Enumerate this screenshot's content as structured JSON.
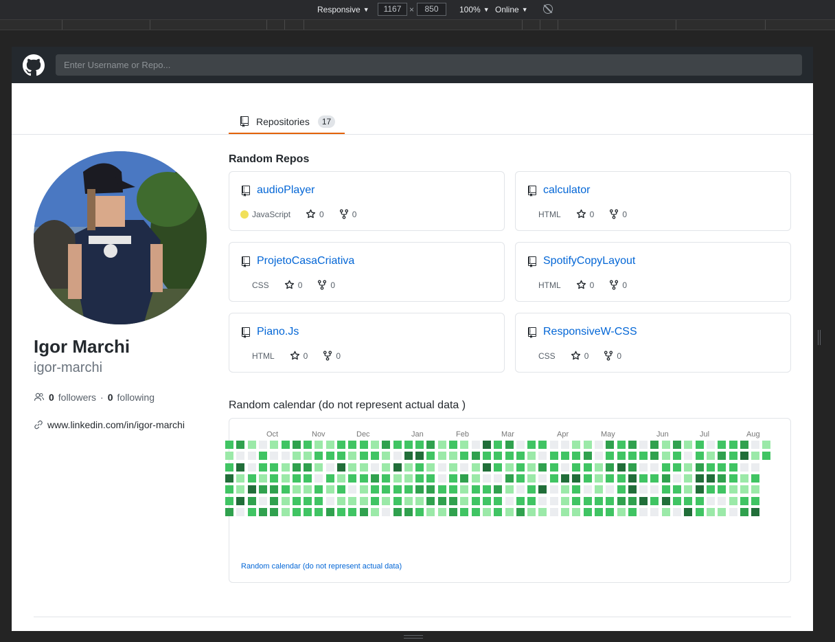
{
  "devtools": {
    "device": "Responsive",
    "width": "1167",
    "height": "850",
    "zoom": "100%",
    "network": "Online"
  },
  "header": {
    "search_placeholder": "Enter Username or Repo..."
  },
  "tabs": [
    {
      "label": "Repositories",
      "count": "17"
    }
  ],
  "profile": {
    "name": "Igor Marchi",
    "login": "igor-marchi",
    "followers": "0",
    "followers_label": "followers",
    "separator": "·",
    "following": "0",
    "following_label": "following",
    "website": "www.linkedin.com/in/igor-marchi"
  },
  "repos_section": {
    "title": "Random Repos",
    "repos": [
      {
        "name": "audioPlayer",
        "language": "JavaScript",
        "stars": "0",
        "forks": "0"
      },
      {
        "name": "calculator",
        "language": "HTML",
        "stars": "0",
        "forks": "0"
      },
      {
        "name": "ProjetoCasaCriativa",
        "language": "CSS",
        "stars": "0",
        "forks": "0"
      },
      {
        "name": "SpotifyCopyLayout",
        "language": "HTML",
        "stars": "0",
        "forks": "0"
      },
      {
        "name": "Piano.Js",
        "language": "HTML",
        "stars": "0",
        "forks": "0"
      },
      {
        "name": "ResponsiveW-CSS",
        "language": "CSS",
        "stars": "0",
        "forks": "0"
      }
    ]
  },
  "calendar": {
    "title": "Random calendar (do not represent actual data )",
    "footer": "Random calendar (do not represent actual data)",
    "months": [
      "Oct",
      "Nov",
      "Dec",
      "Jan",
      "Feb",
      "Mar",
      "Apr",
      "May",
      "Jun",
      "Jul",
      "Aug"
    ],
    "colors": [
      "#ebedf0",
      "#9be9a8",
      "#40c463",
      "#30a14e",
      "#216e39"
    ]
  }
}
